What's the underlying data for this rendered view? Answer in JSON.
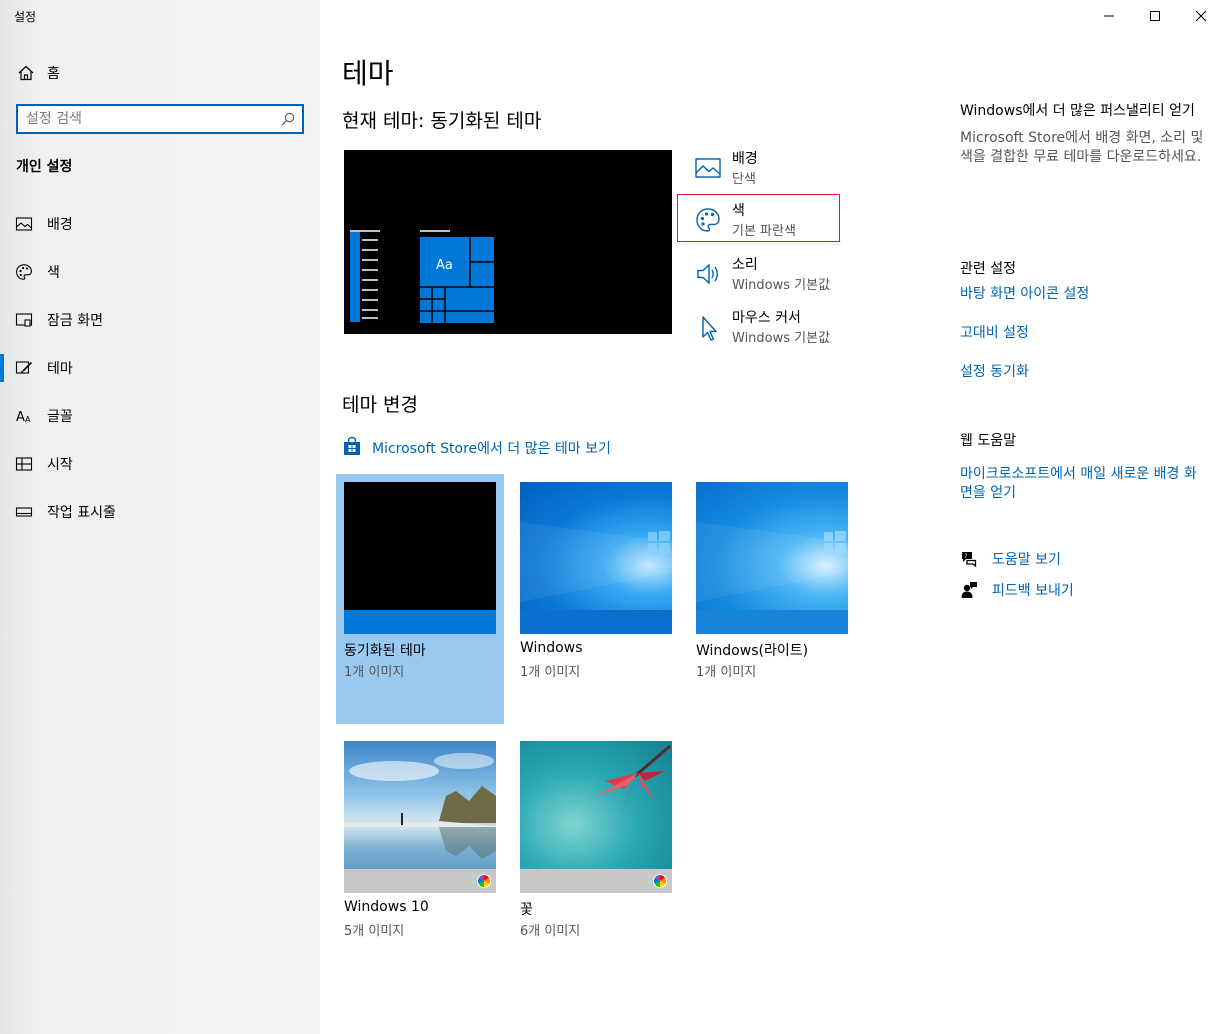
{
  "window": {
    "title": "설정",
    "controls": [
      "minimize",
      "maximize",
      "close"
    ]
  },
  "sidebar": {
    "home_label": "홈",
    "search_placeholder": "설정 검색",
    "section_title": "개인 설정",
    "items": [
      {
        "label": "배경",
        "icon": "picture-icon"
      },
      {
        "label": "색",
        "icon": "palette-icon"
      },
      {
        "label": "잠금 화면",
        "icon": "lock-screen-icon"
      },
      {
        "label": "테마",
        "icon": "theme-brush-icon",
        "active": true
      },
      {
        "label": "글꼴",
        "icon": "font-icon"
      },
      {
        "label": "시작",
        "icon": "start-icon"
      },
      {
        "label": "작업 표시줄",
        "icon": "taskbar-icon"
      }
    ]
  },
  "main": {
    "title": "테마",
    "current_theme": "현재 테마: 동기화된 테마",
    "preview": {
      "tile_label": "Aa"
    },
    "properties": [
      {
        "title": "배경",
        "subtitle": "단색",
        "icon": "picture-icon"
      },
      {
        "title": "색",
        "subtitle": "기본 파란색",
        "icon": "palette-icon",
        "highlighted": true
      },
      {
        "title": "소리",
        "subtitle": "Windows 기본값",
        "icon": "speaker-icon"
      },
      {
        "title": "마우스 커서",
        "subtitle": "Windows 기본값",
        "icon": "cursor-icon"
      }
    ],
    "change_title": "테마 변경",
    "store_link": "Microsoft Store에서 더 많은 테마 보기",
    "themes": [
      {
        "name": "동기화된 테마",
        "count": "1개 이미지",
        "selected": true
      },
      {
        "name": "Windows",
        "count": "1개 이미지"
      },
      {
        "name": "Windows(라이트)",
        "count": "1개 이미지"
      },
      {
        "name": "Windows 10",
        "count": "5개 이미지"
      },
      {
        "name": "꽃",
        "count": "6개 이미지"
      }
    ]
  },
  "right": {
    "promo_title": "Windows에서 더 많은 퍼스낼리티 얻기",
    "promo_text": "Microsoft Store에서 배경 화면, 소리 및 색을 결합한 무료 테마를 다운로드하세요.",
    "related_title": "관련 설정",
    "related_links": [
      "바탕 화면 아이콘 설정",
      "고대비 설정",
      "설정 동기화"
    ],
    "web_help_title": "웹 도움말",
    "web_help_link": "마이크로소프트에서 매일 새로운 배경 화면을 얻기",
    "help_link": "도움말 보기",
    "feedback_link": "피드백 보내기"
  },
  "colors": {
    "accent": "#0078d7",
    "link": "#0063b1",
    "selected_card": "#99c9ef",
    "highlight_box": "#e0191e"
  }
}
